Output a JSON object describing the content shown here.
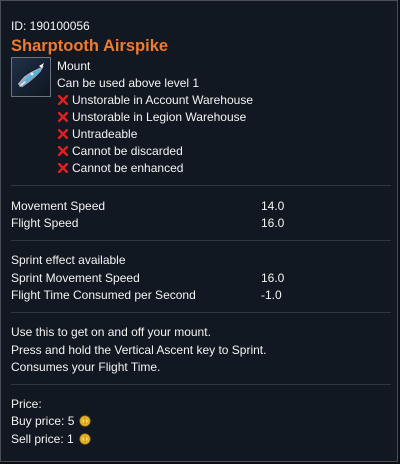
{
  "item": {
    "id_text": "ID: 190100056",
    "name": "Sharptooth Airspike",
    "type": "Mount",
    "level_req": "Can be used above level 1",
    "restrictions": [
      "Unstorable in Account Warehouse",
      "Unstorable in Legion Warehouse",
      "Untradeable",
      "Cannot be discarded",
      "Cannot be enhanced"
    ],
    "name_color": "#f07a2e",
    "icon": "mount-icon"
  },
  "stats": {
    "movement_speed_label": "Movement Speed",
    "movement_speed_value": "14.0",
    "flight_speed_label": "Flight Speed",
    "flight_speed_value": "16.0"
  },
  "sprint": {
    "available": "Sprint effect available",
    "movement_speed_label": "Sprint Movement Speed",
    "movement_speed_value": "16.0",
    "flight_time_label": "Flight Time Consumed per Second",
    "flight_time_value": "-1.0"
  },
  "description": {
    "line1": "Use this to get on and off your mount.",
    "line2": "Press and hold the Vertical Ascent key to Sprint.",
    "line3": "Consumes your Flight Time."
  },
  "price": {
    "header": "Price:",
    "buy": "Buy price: 5",
    "sell": "Sell price: 1",
    "coin_icon": "gold-coin-icon"
  }
}
